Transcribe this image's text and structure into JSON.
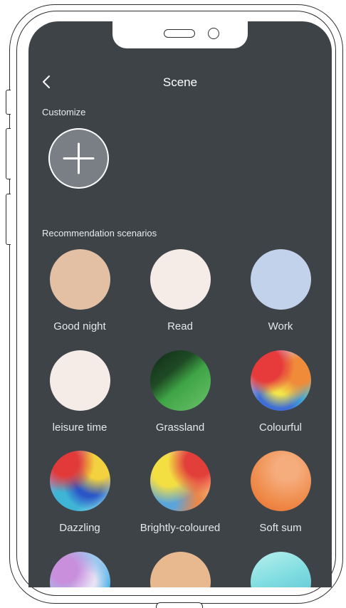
{
  "header": {
    "title": "Scene",
    "back_icon": "chevron-left-icon"
  },
  "customize": {
    "label": "Customize",
    "add_icon": "plus-icon"
  },
  "recommendations": {
    "label": "Recommendation scenarios",
    "items": [
      {
        "label": "Good night",
        "color": "#e3bfa4"
      },
      {
        "label": "Read",
        "color": "#f5ece8"
      },
      {
        "label": "Work",
        "color": "#c3d2eb"
      },
      {
        "label": "leisure time",
        "color": "#f5ece8"
      },
      {
        "label": "Grassland",
        "color": "#3fa546"
      },
      {
        "label": "Colourful",
        "color": "multicolor"
      },
      {
        "label": "Dazzling",
        "color": "multicolor"
      },
      {
        "label": "Brightly-coloured",
        "color": "multicolor"
      },
      {
        "label": "Soft sum",
        "color": "#ef8d4d"
      },
      {
        "label": "",
        "color": "#9fc8ef"
      },
      {
        "label": "",
        "color": "#e8b98e"
      },
      {
        "label": "",
        "color": "#7fdde0"
      }
    ]
  },
  "colors": {
    "screen_bg": "#3e4348",
    "text": "#ffffff"
  }
}
